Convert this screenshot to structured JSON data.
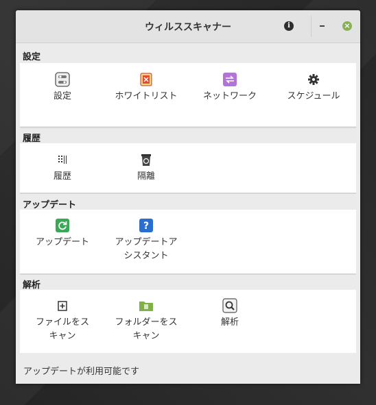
{
  "window": {
    "title": "ウィルススキャナー"
  },
  "titlebar": {
    "info": "i",
    "minimize": "-",
    "close": "×"
  },
  "sections": {
    "settings": {
      "title": "設定",
      "items": [
        "設定",
        "ホワイトリスト",
        "ネットワーク",
        "スケジュール"
      ]
    },
    "history": {
      "title": "履歴",
      "items": [
        "履歴",
        "隔離"
      ]
    },
    "update": {
      "title": "アップデート",
      "items": [
        "アップデート",
        "アップデートア",
        "シスタント"
      ]
    },
    "analysis": {
      "title": "解析",
      "items": [
        "ファイルをス",
        "キャン",
        "フォルダーをス",
        "キャン",
        "解析"
      ]
    }
  },
  "status": "アップデートが利用可能です",
  "colors": {
    "update_icon": "#3aa856",
    "assistant_icon": "#2a6fd0",
    "network_icon": "#b374d8",
    "folder_icon": "#7fb04a"
  }
}
